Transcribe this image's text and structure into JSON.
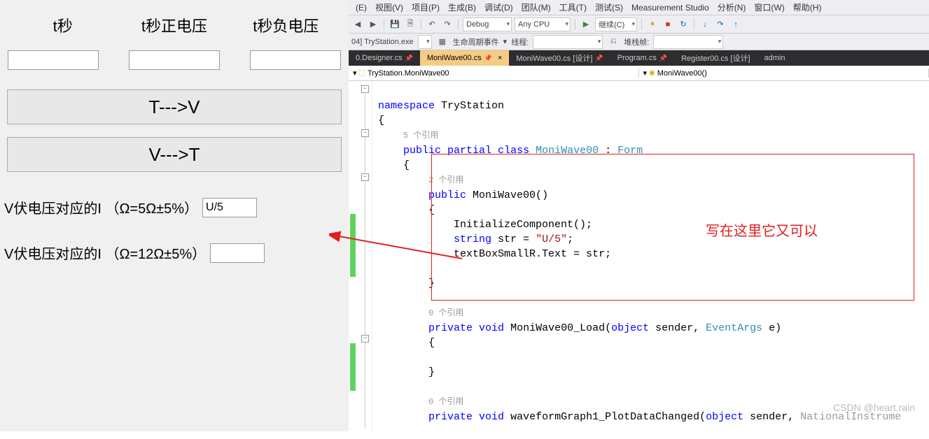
{
  "form": {
    "headers": [
      "t秒",
      "t秒正电压",
      "t秒负电压"
    ],
    "btn_tv": "T--->V",
    "btn_vt": "V--->T",
    "label_5ohm": "V伏电压对应的I （Ω=5Ω±5%）",
    "value_5ohm": "U/5",
    "label_12ohm": "V伏电压对应的I （Ω=12Ω±5%）",
    "value_12ohm": ""
  },
  "menu": [
    "(E)",
    "视图(V)",
    "项目(P)",
    "生成(B)",
    "调试(D)",
    "团队(M)",
    "工具(T)",
    "测试(S)",
    "Measurement Studio",
    "分析(N)",
    "窗口(W)",
    "帮助(H)"
  ],
  "toolbar": {
    "config": "Debug",
    "platform": "Any CPU",
    "continue": "继续(C)"
  },
  "toolbar2": {
    "process": "04] TryStation.exe",
    "events": "生命周期事件",
    "thread": "线程:",
    "stack": "堆栈帧:"
  },
  "tabs": [
    {
      "label": "0.Designer.cs",
      "active": false,
      "pinned": true
    },
    {
      "label": "MoniWave00.cs",
      "active": true,
      "pinned": true
    },
    {
      "label": "MoniWave00.cs [设计]",
      "active": false,
      "pinned": true
    },
    {
      "label": "Program.cs",
      "active": false,
      "pinned": true
    },
    {
      "label": "Register00.cs [设计]",
      "active": false,
      "pinned": false
    },
    {
      "label": "admin",
      "active": false,
      "pinned": false
    }
  ],
  "nav": {
    "left": "TryStation.MoniWave00",
    "right": "MoniWave00()"
  },
  "code": {
    "ns": "namespace",
    "nsname": "TryStation",
    "ref5": "5 个引用",
    "pub": "public",
    "partial": "partial",
    "class": "class",
    "clsname": "MoniWave00",
    "colon": ":",
    "form": "Form",
    "ref2": "2 个引用",
    "ctor": "MoniWave00()",
    "init": "InitializeComponent();",
    "string": "string",
    "strdecl": " str = ",
    "strval": "\"U/5\"",
    "semi": ";",
    "assign": "textBoxSmallR.Text = str;",
    "ref0a": "0 个引用",
    "private": "private",
    "void": "void",
    "load": "MoniWave00_Load",
    "lparen": "(",
    "object": "object",
    "sender": " sender, ",
    "eargs": "EventArgs",
    "e": " e)",
    "ref0b": "0 个引用",
    "wave": "waveformGraph1_PlotDataChanged",
    "sender2": " sender, ",
    "ni": "NationalInstrume"
  },
  "annotation": "写在这里它又可以",
  "watermark": "CSDN @heart.rain"
}
